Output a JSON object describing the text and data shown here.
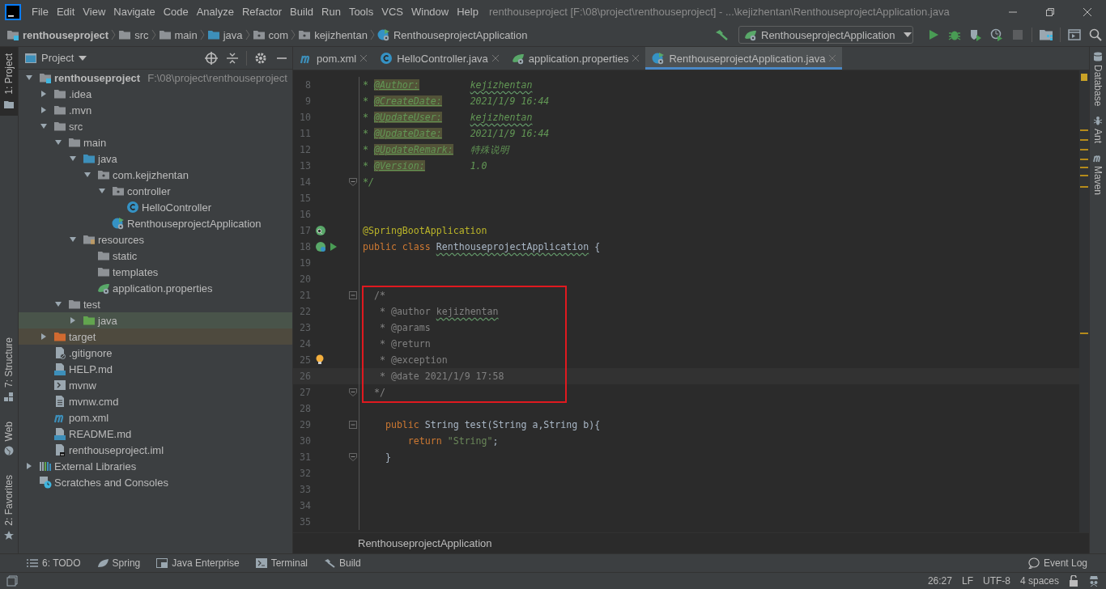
{
  "title_bar": {
    "menu": [
      "File",
      "Edit",
      "View",
      "Navigate",
      "Code",
      "Analyze",
      "Refactor",
      "Build",
      "Run",
      "Tools",
      "VCS",
      "Window",
      "Help"
    ],
    "title": "renthouseproject [F:\\08\\project\\renthouseproject] - ...\\kejizhentan\\RenthouseprojectApplication.java"
  },
  "nav_bar": {
    "breadcrumbs": [
      {
        "label": "renthouseproject",
        "kind": "module"
      },
      {
        "label": "src",
        "kind": "folder"
      },
      {
        "label": "main",
        "kind": "folder"
      },
      {
        "label": "java",
        "kind": "source"
      },
      {
        "label": "com",
        "kind": "package"
      },
      {
        "label": "kejizhentan",
        "kind": "package"
      },
      {
        "label": "RenthouseprojectApplication",
        "kind": "spring-class"
      }
    ],
    "run_config": "RenthouseprojectApplication"
  },
  "left_strip": {
    "top": [
      {
        "label": "1: Project",
        "kind": "project",
        "selected": true
      }
    ],
    "bottom": [
      {
        "label": "7: Structure",
        "kind": "structure",
        "selected": false
      },
      {
        "label": "Web",
        "kind": "web",
        "selected": false
      },
      {
        "label": "2: Favorites",
        "kind": "favorites",
        "selected": false
      }
    ]
  },
  "project_panel": {
    "title": "Project",
    "tree": [
      {
        "label": "renthouseproject",
        "hint": "F:\\08\\project\\renthouseproject",
        "kind": "module",
        "expanded": true,
        "children": [
          {
            "label": ".idea",
            "kind": "folder",
            "expanded": false
          },
          {
            "label": ".mvn",
            "kind": "folder",
            "expanded": false
          },
          {
            "label": "src",
            "kind": "folder",
            "expanded": true,
            "children": [
              {
                "label": "main",
                "kind": "folder",
                "expanded": true,
                "children": [
                  {
                    "label": "java",
                    "kind": "source",
                    "expanded": true,
                    "children": [
                      {
                        "label": "com.kejizhentan",
                        "kind": "package",
                        "expanded": true,
                        "children": [
                          {
                            "label": "controller",
                            "kind": "package",
                            "expanded": true,
                            "children": [
                              {
                                "label": "HelloController",
                                "kind": "class"
                              }
                            ]
                          },
                          {
                            "label": "RenthouseprojectApplication",
                            "kind": "spring-class"
                          }
                        ]
                      }
                    ]
                  },
                  {
                    "label": "resources",
                    "kind": "resources",
                    "expanded": true,
                    "children": [
                      {
                        "label": "static",
                        "kind": "folder"
                      },
                      {
                        "label": "templates",
                        "kind": "folder"
                      },
                      {
                        "label": "application.properties",
                        "kind": "spring-props"
                      }
                    ]
                  }
                ]
              },
              {
                "label": "test",
                "kind": "folder",
                "expanded": true,
                "children": [
                  {
                    "label": "java",
                    "kind": "test-source",
                    "expanded": false,
                    "color": "#49544a"
                  }
                ]
              }
            ]
          },
          {
            "label": "target",
            "kind": "excluded",
            "expanded": false,
            "color": "#4e4a3e"
          },
          {
            "label": ".gitignore",
            "kind": "ignore"
          },
          {
            "label": "HELP.md",
            "kind": "md"
          },
          {
            "label": "mvnw",
            "kind": "shell"
          },
          {
            "label": "mvnw.cmd",
            "kind": "text"
          },
          {
            "label": "pom.xml",
            "kind": "maven"
          },
          {
            "label": "README.md",
            "kind": "md"
          },
          {
            "label": "renthouseproject.iml",
            "kind": "iml"
          }
        ]
      },
      {
        "label": "External Libraries",
        "kind": "libraries",
        "expanded": false
      },
      {
        "label": "Scratches and Consoles",
        "kind": "scratches"
      }
    ]
  },
  "editor": {
    "tabs": [
      {
        "label": "pom.xml",
        "kind": "maven",
        "selected": false
      },
      {
        "label": "HelloController.java",
        "kind": "class",
        "selected": false
      },
      {
        "label": "application.properties",
        "kind": "spring-props",
        "selected": false
      },
      {
        "label": "RenthouseprojectApplication.java",
        "kind": "spring-class",
        "selected": true
      }
    ],
    "blocks": [
      {
        "boxed": false,
        "lines": [
          {
            "n": "8",
            "segs": [
              {
                "t": "* ",
                "kind": "doc"
              },
              {
                "t": "@Author:",
                "kind": "doctag"
              },
              {
                "t": "kejizhentan",
                "kind": "docvalue",
                "typo": true
              }
            ]
          },
          {
            "n": "9",
            "segs": [
              {
                "t": "* ",
                "kind": "doc"
              },
              {
                "t": "@CreateDate:",
                "kind": "doctag"
              },
              {
                "t": "2021/1/9 16:44",
                "kind": "docvalue"
              }
            ]
          },
          {
            "n": "10",
            "segs": [
              {
                "t": "* ",
                "kind": "doc"
              },
              {
                "t": "@UpdateUser:",
                "kind": "doctag"
              },
              {
                "t": "kejizhentan",
                "kind": "docvalue",
                "typo": true
              }
            ]
          },
          {
            "n": "11",
            "segs": [
              {
                "t": "* ",
                "kind": "doc"
              },
              {
                "t": "@UpdateDate:",
                "kind": "doctag"
              },
              {
                "t": "2021/1/9 16:44",
                "kind": "docvalue"
              }
            ]
          },
          {
            "n": "12",
            "segs": [
              {
                "t": "* ",
                "kind": "doc"
              },
              {
                "t": "@UpdateRemark:",
                "kind": "doctag"
              },
              {
                "t": "特殊说明",
                "kind": "docvalue"
              }
            ]
          },
          {
            "n": "13",
            "segs": [
              {
                "t": "* ",
                "kind": "doc"
              },
              {
                "t": "@Version:",
                "kind": "doctag"
              },
              {
                "t": "1.0",
                "kind": "docvalue"
              }
            ]
          },
          {
            "n": "14",
            "fold": {
              "kind": "end"
            },
            "segs": [
              {
                "t": "*/",
                "kind": "doc"
              }
            ]
          },
          {
            "n": "15"
          },
          {
            "n": "16"
          },
          {
            "n": "17",
            "gutter": {
              "kind": "bean"
            },
            "segs": [
              {
                "t": "@SpringBootApplication",
                "kind": "annotation"
              }
            ]
          },
          {
            "n": "18",
            "gutter": {
              "kind": "bean-run"
            },
            "segs": [
              {
                "t": "public class ",
                "kind": "keyword"
              },
              {
                "t": "RenthouseprojectApplication",
                "kind": "plain",
                "typo": true
              },
              {
                "t": " {",
                "kind": "plain"
              }
            ]
          },
          {
            "n": "19"
          },
          {
            "n": "20"
          }
        ]
      },
      {
        "boxed": true,
        "lines": [
          {
            "n": "21",
            "fold": {
              "kind": "start"
            },
            "segs": [
              {
                "t": "  /*",
                "kind": "comment"
              }
            ]
          },
          {
            "n": "22",
            "segs": [
              {
                "t": "   * @author ",
                "kind": "comment"
              },
              {
                "t": "kejizhentan",
                "kind": "comment",
                "typo": true
              }
            ]
          },
          {
            "n": "23",
            "segs": [
              {
                "t": "   * @params",
                "kind": "comment"
              }
            ]
          },
          {
            "n": "24",
            "segs": [
              {
                "t": "   * @return",
                "kind": "comment"
              }
            ]
          },
          {
            "n": "25",
            "gutter": {
              "kind": "bulb"
            },
            "segs": [
              {
                "t": "   * @exception",
                "kind": "comment"
              }
            ]
          },
          {
            "n": "26",
            "current": true,
            "segs": [
              {
                "t": "   * @date 2021/1/9 17:58",
                "kind": "comment"
              }
            ]
          },
          {
            "n": "27",
            "fold": {
              "kind": "end"
            },
            "segs": [
              {
                "t": "  */",
                "kind": "comment"
              }
            ]
          }
        ]
      },
      {
        "boxed": false,
        "lines": [
          {
            "n": "28"
          },
          {
            "n": "29",
            "fold": {
              "kind": "start"
            },
            "segs": [
              {
                "t": "    public ",
                "kind": "keyword"
              },
              {
                "t": "String test(String a,String b){",
                "kind": "plain"
              }
            ]
          },
          {
            "n": "30",
            "segs": [
              {
                "t": "        return ",
                "kind": "keyword"
              },
              {
                "t": "\"String\"",
                "kind": "string"
              },
              {
                "t": ";",
                "kind": "plain"
              }
            ]
          },
          {
            "n": "31",
            "fold": {
              "kind": "end"
            },
            "segs": [
              {
                "t": "    }",
                "kind": "plain"
              }
            ]
          },
          {
            "n": "32"
          },
          {
            "n": "33"
          },
          {
            "n": "34"
          },
          {
            "n": "35"
          }
        ]
      }
    ],
    "breadcrumb": "RenthouseprojectApplication"
  },
  "right_strip": [
    {
      "label": "Database",
      "kind": "database"
    },
    {
      "label": "Ant",
      "kind": "ant"
    },
    {
      "label": "Maven",
      "kind": "maven"
    }
  ],
  "tool_bar": {
    "left": [
      {
        "label": "6: TODO",
        "kind": "todo"
      },
      {
        "label": "Spring",
        "kind": "spring"
      },
      {
        "label": "Java Enterprise",
        "kind": "enterprise"
      },
      {
        "label": "Terminal",
        "kind": "terminal"
      },
      {
        "label": "Build",
        "kind": "build"
      }
    ],
    "right": {
      "label": "Event Log",
      "kind": "log"
    }
  },
  "status_bar": [
    "26:27",
    "LF",
    "UTF-8",
    "4 spaces"
  ]
}
